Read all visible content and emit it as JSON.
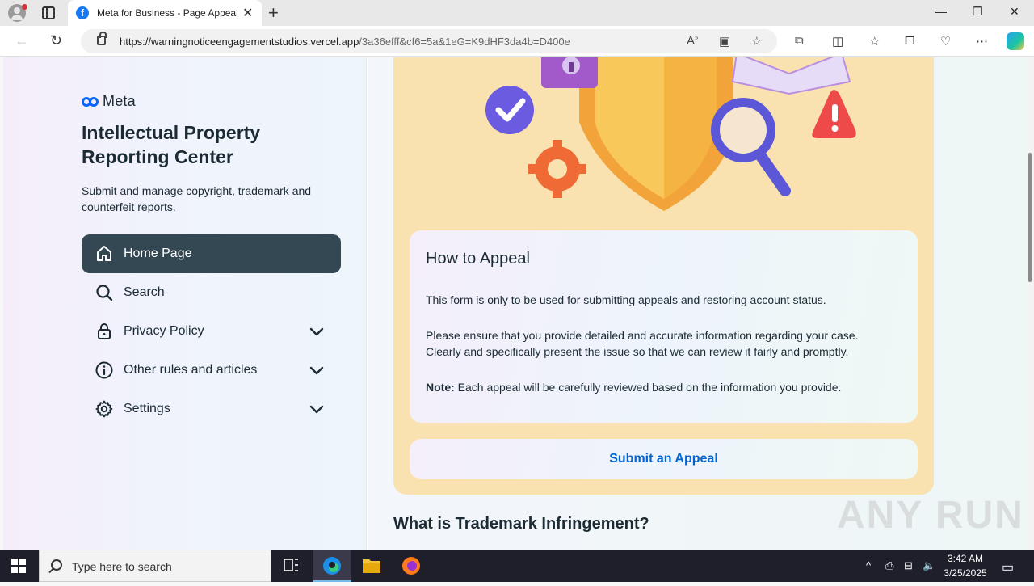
{
  "browser": {
    "tab_title": "Meta for Business - Page Appeal",
    "url_host": "https://warningnoticeengagementstudios.vercel.app",
    "url_path": "/3a36efff&cf6=5a&1eG=K9dHF3da4b=D400e"
  },
  "sidebar": {
    "brand": "Meta",
    "title": "Intellectual Property Reporting Center",
    "description": "Submit and manage copyright, trademark and counterfeit reports.",
    "items": [
      {
        "label": "Home Page",
        "icon": "home-icon",
        "active": true
      },
      {
        "label": "Search",
        "icon": "search-icon"
      },
      {
        "label": "Privacy Policy",
        "icon": "lock-icon",
        "expandable": true
      },
      {
        "label": "Other rules and articles",
        "icon": "info-icon",
        "expandable": true
      },
      {
        "label": "Settings",
        "icon": "gear-icon",
        "expandable": true
      }
    ]
  },
  "main": {
    "card": {
      "title": "How to Appeal",
      "p1": "This form is only to be used for submitting appeals and restoring account status.",
      "p2": "Please ensure that you provide detailed and accurate information regarding your case. Clearly and specifically present the issue so that we can review it fairly and promptly.",
      "note_label": "Note:",
      "note_text": " Each appeal will be carefully reviewed based on the information you provide."
    },
    "submit_label": "Submit an Appeal",
    "section_heading": "What is Trademark Infringement?"
  },
  "watermark": "ANY RUN",
  "taskbar": {
    "search_placeholder": "Type here to search",
    "time": "3:42 AM",
    "date": "3/25/2025"
  },
  "colors": {
    "accent": "#0064d1",
    "sidebar_active": "#344854",
    "panel": "#f9e2b0",
    "meta_blue": "#0866ff"
  }
}
